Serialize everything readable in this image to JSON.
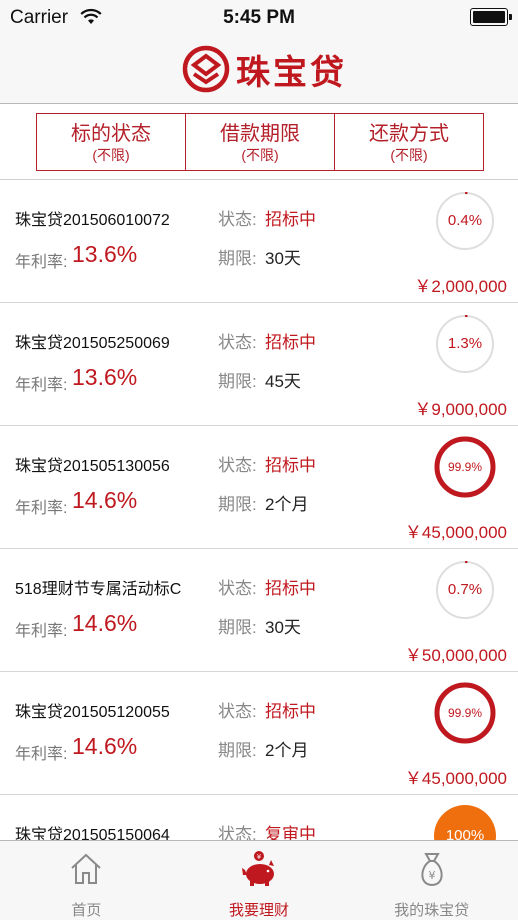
{
  "status_bar": {
    "carrier": "Carrier",
    "time": "5:45 PM"
  },
  "header": {
    "app_name": "珠宝贷"
  },
  "filters": [
    {
      "title": "标的状态",
      "value": "(不限)"
    },
    {
      "title": "借款期限",
      "value": "(不限)"
    },
    {
      "title": "还款方式",
      "value": "(不限)"
    }
  ],
  "labels": {
    "rate": "年利率:",
    "status": "状态:",
    "term": "期限:"
  },
  "loans": [
    {
      "name": "珠宝贷201506010072",
      "rate": "13.6%",
      "status": "招标中",
      "term": "30天",
      "progress": 0.004,
      "progress_text": "0.4%",
      "amount": "￥2,000,000"
    },
    {
      "name": "珠宝贷201505250069",
      "rate": "13.6%",
      "status": "招标中",
      "term": "45天",
      "progress": 0.013,
      "progress_text": "1.3%",
      "amount": "￥9,000,000"
    },
    {
      "name": "珠宝贷201505130056",
      "rate": "14.6%",
      "status": "招标中",
      "term": "2个月",
      "progress": 0.999,
      "progress_text": "99.9%",
      "amount": "￥45,000,000"
    },
    {
      "name": "518理财节专属活动标C",
      "rate": "14.6%",
      "status": "招标中",
      "term": "30天",
      "progress": 0.007,
      "progress_text": "0.7%",
      "amount": "￥50,000,000"
    },
    {
      "name": "珠宝贷201505120055",
      "rate": "14.6%",
      "status": "招标中",
      "term": "2个月",
      "progress": 0.999,
      "progress_text": "99.9%",
      "amount": "￥45,000,000"
    },
    {
      "name": "珠宝贷201505150064",
      "rate": "",
      "status": "复审中",
      "term": "",
      "progress": 1.0,
      "progress_text": "100%",
      "amount": ""
    }
  ],
  "tabs": [
    {
      "label": "首页",
      "icon": "home-icon",
      "active": false
    },
    {
      "label": "我要理财",
      "icon": "piggy-bank-icon",
      "active": true
    },
    {
      "label": "我的珠宝贷",
      "icon": "money-bag-icon",
      "active": false
    }
  ],
  "colors": {
    "brand_red": "#c0181f",
    "ring_track": "#dedede",
    "ring_full_orange": "#ef6f0f",
    "tab_inactive": "#888888"
  }
}
